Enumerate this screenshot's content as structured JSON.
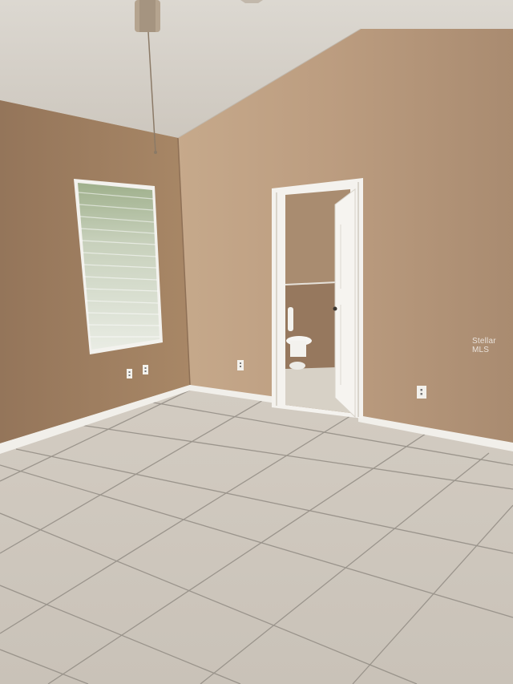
{
  "scene": {
    "description_label": "",
    "colors": {
      "ceiling": "#d7d2ca",
      "wall_left": "#9e7d5f",
      "wall_back": "#b89a7e",
      "floor": "#cfc8bd",
      "grout": "#8f8a83",
      "trim": "#f2f0ec",
      "window_glass": "#e8eee2",
      "bathroom_wall": "#a98c70",
      "door": "#f5f3ef",
      "fan_rod": "#8b7a67"
    },
    "icons": [
      "ceiling-fan-icon",
      "outlet-icon",
      "toilet-icon"
    ]
  },
  "watermark": {
    "text": "Stellar MLS"
  }
}
